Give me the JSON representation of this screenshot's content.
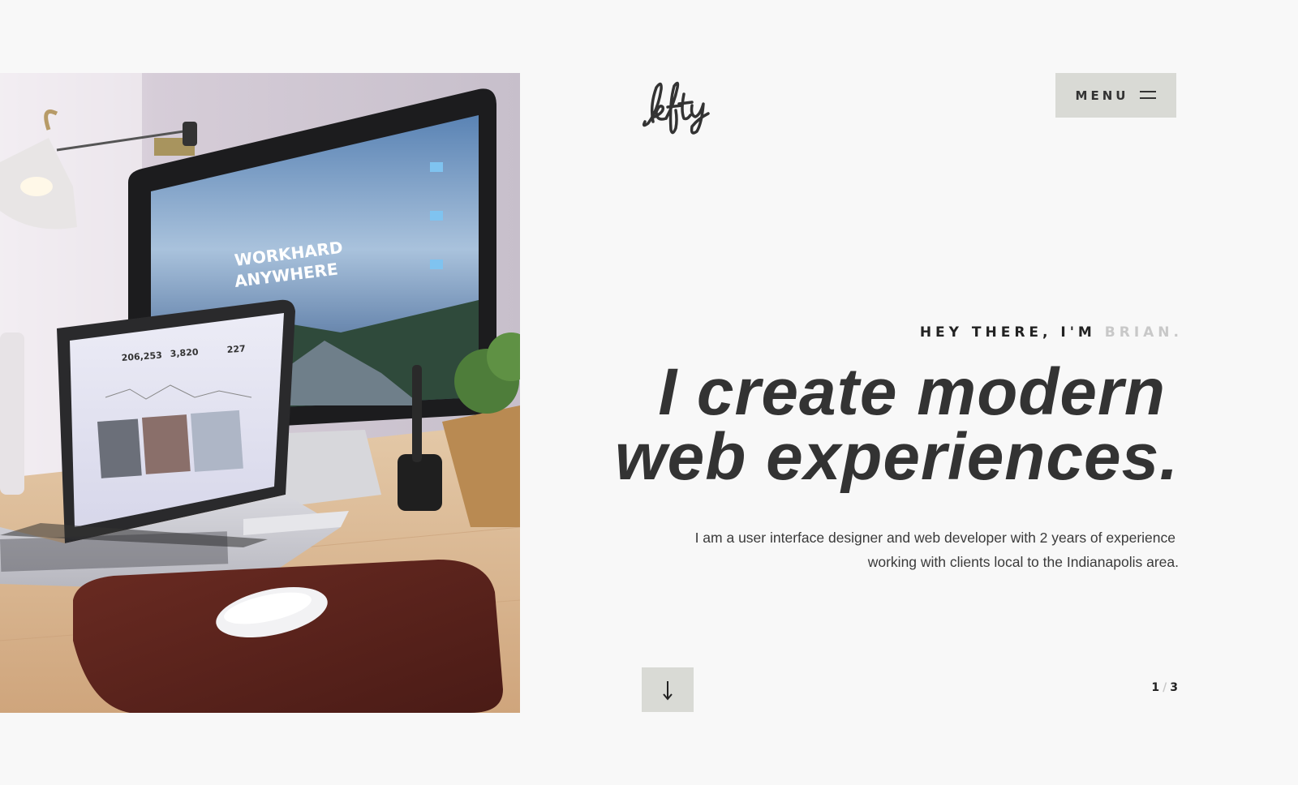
{
  "brand": {
    "logo_text": "lefty"
  },
  "nav": {
    "menu_label": "MENU",
    "menu_icon": "hamburger-icon"
  },
  "hero": {
    "greeting_prefix": "HEY THERE, I'M",
    "greeting_name": "BRIAN.",
    "headline_line1": "I create modern",
    "headline_line2": "web experiences.",
    "bio_line1": "I am a user interface designer and web developer with 2 years of experience",
    "bio_line2": "working with clients local to the Indianapolis area.",
    "image_monitor_text_line1": "WORKHARD",
    "image_monitor_text_line2": "ANYWHERE",
    "image_laptop_stats": [
      "206,253",
      "3,820",
      "227"
    ]
  },
  "scroll": {
    "icon": "arrow-down-icon"
  },
  "pager": {
    "current": "1",
    "separator": "/",
    "total": "3"
  },
  "colors": {
    "background": "#f8f8f8",
    "button_bg": "#d9dad5",
    "text_dark": "#333333",
    "text_muted": "#c8c8c8"
  }
}
